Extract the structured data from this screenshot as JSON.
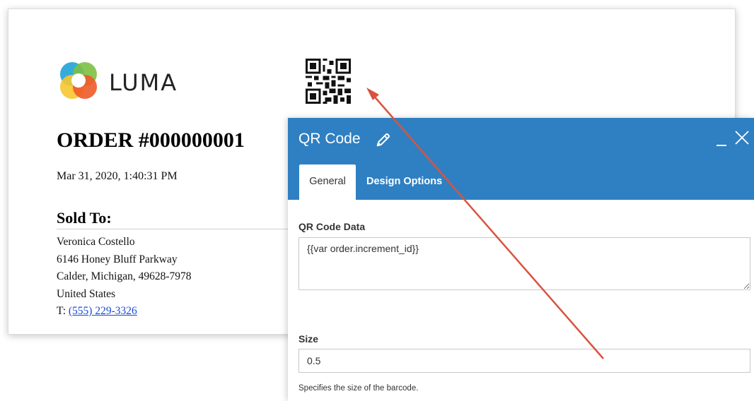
{
  "invoice": {
    "logo_text": "LUMA",
    "order_title": "ORDER #000000001",
    "order_date": "Mar 31, 2020, 1:40:31 PM",
    "sold_to_heading": "Sold To:",
    "customer_name": "Veronica Costello",
    "street": "6146 Honey Bluff Parkway",
    "city_line": "Calder, Michigan, 49628-7978",
    "country": "United States",
    "phone_prefix": "T: ",
    "phone": "(555) 229-3326"
  },
  "modal": {
    "title": "QR Code",
    "tabs": [
      {
        "label": "General",
        "active": true
      },
      {
        "label": "Design Options",
        "active": false
      }
    ],
    "qr_data_label": "QR Code Data",
    "qr_data_value": "{{var order.increment_id}}",
    "size_label": "Size",
    "size_value": "0.5",
    "size_help": "Specifies the size of the barcode."
  },
  "icons": {
    "edit": "pencil-icon",
    "minimize": "minimize-icon",
    "close": "close-icon",
    "logo": "luma-logo-icon",
    "qr": "qr-code-icon",
    "arrow": "annotation-arrow"
  },
  "colors": {
    "modal_header": "#2f80c2",
    "link": "#1a4ad6",
    "arrow": "#d9533f"
  }
}
